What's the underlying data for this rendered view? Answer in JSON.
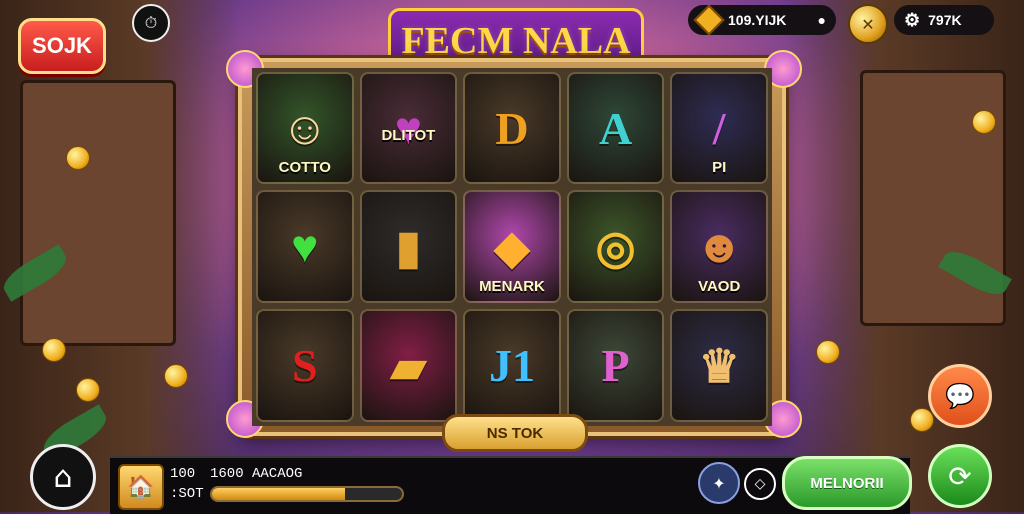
{
  "header": {
    "logo_text": "SOJK",
    "title": "FECM NALA",
    "currency_pill": {
      "icon": "gem-icon",
      "value": "109.YIJK"
    },
    "coin_button_icon": "coin-icon",
    "balance_pill": {
      "icon": "gear-icon",
      "value": "797K"
    }
  },
  "reels": {
    "rows": [
      [
        {
          "glyph": "☺",
          "label": "COTTO",
          "bg": "#2f5a2a",
          "fg": "#ffd7a0"
        },
        {
          "glyph": "♥",
          "label": "",
          "text": "DLITOT",
          "bg": "#4a2a3a",
          "fg": "#c040c0"
        },
        {
          "glyph": "D",
          "label": "",
          "bg": "#4a3a28",
          "fg": "#f0a020"
        },
        {
          "glyph": "A",
          "label": "",
          "bg": "#2a4a3a",
          "fg": "#40d0d0"
        },
        {
          "glyph": "/",
          "label": "PI",
          "bg": "#2a2a5a",
          "fg": "#d060e0"
        }
      ],
      [
        {
          "glyph": "♥",
          "label": "",
          "bg": "#4a3a28",
          "fg": "#40e040"
        },
        {
          "glyph": "▮",
          "label": "",
          "bg": "#2a2a2a",
          "fg": "#e0a030"
        },
        {
          "glyph": "◆",
          "label": "MENARK",
          "bg": "#c04ac0",
          "fg": "#ffb030"
        },
        {
          "glyph": "◎",
          "label": "",
          "bg": "#3a5a2a",
          "fg": "#f0c030"
        },
        {
          "glyph": "☻",
          "label": "VAOD",
          "bg": "#4a2a6a",
          "fg": "#e08a40"
        }
      ],
      [
        {
          "glyph": "S",
          "label": "",
          "bg": "#4a3a28",
          "fg": "#e02020"
        },
        {
          "glyph": "▰",
          "label": "",
          "bg": "#8a1a4a",
          "fg": "#f0b030"
        },
        {
          "glyph": "J1",
          "label": "",
          "bg": "#4a3a28",
          "fg": "#40c0ff"
        },
        {
          "glyph": "P",
          "label": "",
          "bg": "#3a4a3a",
          "fg": "#e060d0"
        },
        {
          "glyph": "♛",
          "label": "",
          "bg": "#2a2a4a",
          "fg": "#f0c070"
        }
      ]
    ]
  },
  "spin_label": "NS TOK",
  "footer": {
    "stat1_label": "100",
    "stat1_value": "1600 AACAOG",
    "stat2_label": ":SOT",
    "progress_value": 0.7,
    "cta_label": "MELNORII"
  },
  "colors": {
    "accent": "#ffcf3a",
    "title_bg": "#6a1a90",
    "cta_green": "#2a9a2a"
  }
}
